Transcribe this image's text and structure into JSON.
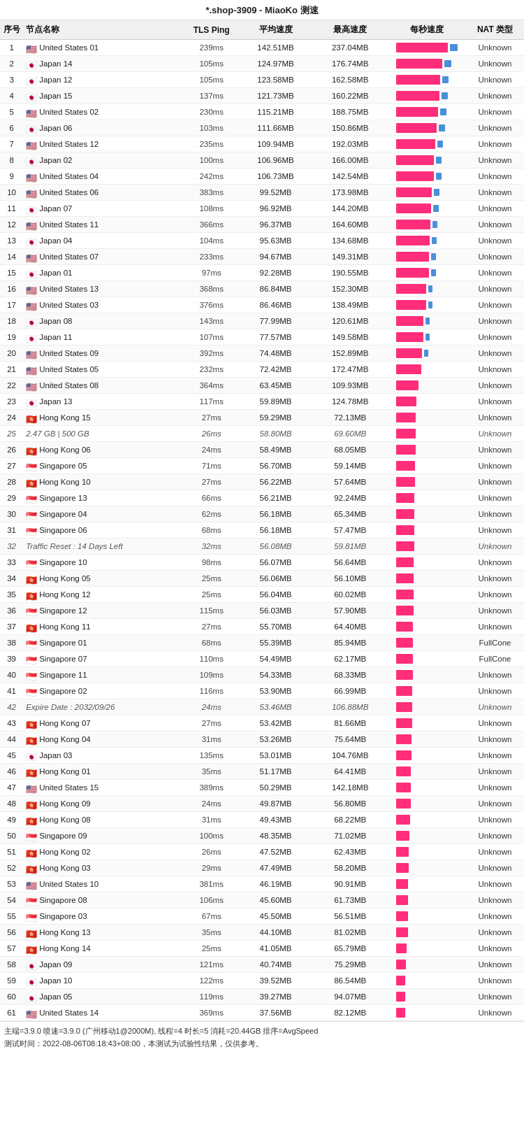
{
  "title": "*.shop-3909 - MiaoKo 测速",
  "columns": [
    "序号",
    "节点名称",
    "TLS Ping",
    "平均速度",
    "最高速度",
    "每秒速度",
    "NAT 类型"
  ],
  "rows": [
    {
      "id": 1,
      "flag": "us",
      "name": "United States 01",
      "ping": "239ms",
      "avg": "142.51MB",
      "max": "237.04MB",
      "bar": 95,
      "nat": "Unknown"
    },
    {
      "id": 2,
      "flag": "jp",
      "name": "Japan 14",
      "ping": "105ms",
      "avg": "124.97MB",
      "max": "176.74MB",
      "bar": 83,
      "nat": "Unknown"
    },
    {
      "id": 3,
      "flag": "jp",
      "name": "Japan 12",
      "ping": "105ms",
      "avg": "123.58MB",
      "max": "162.58MB",
      "bar": 80,
      "nat": "Unknown"
    },
    {
      "id": 4,
      "flag": "jp",
      "name": "Japan 15",
      "ping": "137ms",
      "avg": "121.73MB",
      "max": "160.22MB",
      "bar": 78,
      "nat": "Unknown"
    },
    {
      "id": 5,
      "flag": "us",
      "name": "United States 02",
      "ping": "230ms",
      "avg": "115.21MB",
      "max": "188.75MB",
      "bar": 76,
      "nat": "Unknown"
    },
    {
      "id": 6,
      "flag": "jp",
      "name": "Japan 06",
      "ping": "103ms",
      "avg": "111.66MB",
      "max": "150.86MB",
      "bar": 73,
      "nat": "Unknown"
    },
    {
      "id": 7,
      "flag": "us",
      "name": "United States 12",
      "ping": "235ms",
      "avg": "109.94MB",
      "max": "192.03MB",
      "bar": 71,
      "nat": "Unknown"
    },
    {
      "id": 8,
      "flag": "jp",
      "name": "Japan 02",
      "ping": "100ms",
      "avg": "106.96MB",
      "max": "166.00MB",
      "bar": 69,
      "nat": "Unknown"
    },
    {
      "id": 9,
      "flag": "us",
      "name": "United States 04",
      "ping": "242ms",
      "avg": "106.73MB",
      "max": "142.54MB",
      "bar": 68,
      "nat": "Unknown"
    },
    {
      "id": 10,
      "flag": "us",
      "name": "United States 06",
      "ping": "383ms",
      "avg": "99.52MB",
      "max": "173.98MB",
      "bar": 65,
      "nat": "Unknown"
    },
    {
      "id": 11,
      "flag": "jp",
      "name": "Japan 07",
      "ping": "108ms",
      "avg": "96.92MB",
      "max": "144.20MB",
      "bar": 63,
      "nat": "Unknown"
    },
    {
      "id": 12,
      "flag": "us",
      "name": "United States 11",
      "ping": "366ms",
      "avg": "96.37MB",
      "max": "164.60MB",
      "bar": 62,
      "nat": "Unknown"
    },
    {
      "id": 13,
      "flag": "jp",
      "name": "Japan 04",
      "ping": "104ms",
      "avg": "95.63MB",
      "max": "134.68MB",
      "bar": 61,
      "nat": "Unknown"
    },
    {
      "id": 14,
      "flag": "us",
      "name": "United States 07",
      "ping": "233ms",
      "avg": "94.67MB",
      "max": "149.31MB",
      "bar": 60,
      "nat": "Unknown"
    },
    {
      "id": 15,
      "flag": "jp",
      "name": "Japan 01",
      "ping": "97ms",
      "avg": "92.28MB",
      "max": "190.55MB",
      "bar": 59,
      "nat": "Unknown"
    },
    {
      "id": 16,
      "flag": "us",
      "name": "United States 13",
      "ping": "368ms",
      "avg": "86.84MB",
      "max": "152.30MB",
      "bar": 55,
      "nat": "Unknown"
    },
    {
      "id": 17,
      "flag": "us",
      "name": "United States 03",
      "ping": "376ms",
      "avg": "86.46MB",
      "max": "138.49MB",
      "bar": 54,
      "nat": "Unknown"
    },
    {
      "id": 18,
      "flag": "jp",
      "name": "Japan 08",
      "ping": "143ms",
      "avg": "77.99MB",
      "max": "120.61MB",
      "bar": 50,
      "nat": "Unknown"
    },
    {
      "id": 19,
      "flag": "jp",
      "name": "Japan 11",
      "ping": "107ms",
      "avg": "77.57MB",
      "max": "149.58MB",
      "bar": 49,
      "nat": "Unknown"
    },
    {
      "id": 20,
      "flag": "us",
      "name": "United States 09",
      "ping": "392ms",
      "avg": "74.48MB",
      "max": "152.89MB",
      "bar": 47,
      "nat": "Unknown"
    },
    {
      "id": 21,
      "flag": "us",
      "name": "United States 05",
      "ping": "232ms",
      "avg": "72.42MB",
      "max": "172.47MB",
      "bar": 46,
      "nat": "Unknown"
    },
    {
      "id": 22,
      "flag": "us",
      "name": "United States 08",
      "ping": "364ms",
      "avg": "63.45MB",
      "max": "109.93MB",
      "bar": 40,
      "nat": "Unknown"
    },
    {
      "id": 23,
      "flag": "jp",
      "name": "Japan 13",
      "ping": "117ms",
      "avg": "59.89MB",
      "max": "124.78MB",
      "bar": 37,
      "nat": "Unknown"
    },
    {
      "id": 24,
      "flag": "hk",
      "name": "Hong Kong 15",
      "ping": "27ms",
      "avg": "59.29MB",
      "max": "72.13MB",
      "bar": 36,
      "nat": "Unknown"
    },
    {
      "id": 25,
      "flag": "special",
      "name": "2.47 GB | 500 GB",
      "ping": "26ms",
      "avg": "58.80MB",
      "max": "69.60MB",
      "bar": 35,
      "nat": "Unknown"
    },
    {
      "id": 26,
      "flag": "hk",
      "name": "Hong Kong 06",
      "ping": "24ms",
      "avg": "58.49MB",
      "max": "68.05MB",
      "bar": 35,
      "nat": "Unknown"
    },
    {
      "id": 27,
      "flag": "sg",
      "name": "Singapore 05",
      "ping": "71ms",
      "avg": "56.70MB",
      "max": "59.14MB",
      "bar": 34,
      "nat": "Unknown"
    },
    {
      "id": 28,
      "flag": "hk",
      "name": "Hong Kong 10",
      "ping": "27ms",
      "avg": "56.22MB",
      "max": "57.64MB",
      "bar": 34,
      "nat": "Unknown"
    },
    {
      "id": 29,
      "flag": "sg",
      "name": "Singapore 13",
      "ping": "66ms",
      "avg": "56.21MB",
      "max": "92.24MB",
      "bar": 33,
      "nat": "Unknown"
    },
    {
      "id": 30,
      "flag": "sg",
      "name": "Singapore 04",
      "ping": "62ms",
      "avg": "56.18MB",
      "max": "65.34MB",
      "bar": 33,
      "nat": "Unknown"
    },
    {
      "id": 31,
      "flag": "sg",
      "name": "Singapore 06",
      "ping": "68ms",
      "avg": "56.18MB",
      "max": "57.47MB",
      "bar": 33,
      "nat": "Unknown"
    },
    {
      "id": 32,
      "flag": "special",
      "name": "Traffic Reset : 14 Days Left",
      "ping": "32ms",
      "avg": "56.08MB",
      "max": "59.81MB",
      "bar": 33,
      "nat": "Unknown"
    },
    {
      "id": 33,
      "flag": "sg",
      "name": "Singapore 10",
      "ping": "98ms",
      "avg": "56.07MB",
      "max": "56.64MB",
      "bar": 32,
      "nat": "Unknown"
    },
    {
      "id": 34,
      "flag": "hk",
      "name": "Hong Kong 05",
      "ping": "25ms",
      "avg": "56.06MB",
      "max": "56.10MB",
      "bar": 32,
      "nat": "Unknown"
    },
    {
      "id": 35,
      "flag": "hk",
      "name": "Hong Kong 12",
      "ping": "25ms",
      "avg": "56.04MB",
      "max": "60.02MB",
      "bar": 32,
      "nat": "Unknown"
    },
    {
      "id": 36,
      "flag": "sg",
      "name": "Singapore 12",
      "ping": "115ms",
      "avg": "56.03MB",
      "max": "57.90MB",
      "bar": 32,
      "nat": "Unknown"
    },
    {
      "id": 37,
      "flag": "hk",
      "name": "Hong Kong 11",
      "ping": "27ms",
      "avg": "55.70MB",
      "max": "64.40MB",
      "bar": 31,
      "nat": "Unknown"
    },
    {
      "id": 38,
      "flag": "sg",
      "name": "Singapore 01",
      "ping": "68ms",
      "avg": "55.39MB",
      "max": "85.94MB",
      "bar": 31,
      "nat": "FullCone"
    },
    {
      "id": 39,
      "flag": "sg",
      "name": "Singapore 07",
      "ping": "110ms",
      "avg": "54.49MB",
      "max": "62.17MB",
      "bar": 30,
      "nat": "FullCone"
    },
    {
      "id": 40,
      "flag": "sg",
      "name": "Singapore 11",
      "ping": "109ms",
      "avg": "54.33MB",
      "max": "68.33MB",
      "bar": 30,
      "nat": "Unknown"
    },
    {
      "id": 41,
      "flag": "sg",
      "name": "Singapore 02",
      "ping": "116ms",
      "avg": "53.90MB",
      "max": "66.99MB",
      "bar": 29,
      "nat": "Unknown"
    },
    {
      "id": 42,
      "flag": "special",
      "name": "Expire Date : 2032/09/26",
      "ping": "24ms",
      "avg": "53.46MB",
      "max": "106.88MB",
      "bar": 29,
      "nat": "Unknown"
    },
    {
      "id": 43,
      "flag": "hk",
      "name": "Hong Kong 07",
      "ping": "27ms",
      "avg": "53.42MB",
      "max": "81.66MB",
      "bar": 29,
      "nat": "Unknown"
    },
    {
      "id": 44,
      "flag": "hk",
      "name": "Hong Kong 04",
      "ping": "31ms",
      "avg": "53.26MB",
      "max": "75.64MB",
      "bar": 28,
      "nat": "Unknown"
    },
    {
      "id": 45,
      "flag": "jp",
      "name": "Japan 03",
      "ping": "135ms",
      "avg": "53.01MB",
      "max": "104.76MB",
      "bar": 28,
      "nat": "Unknown"
    },
    {
      "id": 46,
      "flag": "hk",
      "name": "Hong Kong 01",
      "ping": "35ms",
      "avg": "51.17MB",
      "max": "64.41MB",
      "bar": 27,
      "nat": "Unknown"
    },
    {
      "id": 47,
      "flag": "us",
      "name": "United States 15",
      "ping": "389ms",
      "avg": "50.29MB",
      "max": "142.18MB",
      "bar": 27,
      "nat": "Unknown"
    },
    {
      "id": 48,
      "flag": "hk",
      "name": "Hong Kong 09",
      "ping": "24ms",
      "avg": "49.87MB",
      "max": "56.80MB",
      "bar": 26,
      "nat": "Unknown"
    },
    {
      "id": 49,
      "flag": "hk",
      "name": "Hong Kong 08",
      "ping": "31ms",
      "avg": "49.43MB",
      "max": "68.22MB",
      "bar": 25,
      "nat": "Unknown"
    },
    {
      "id": 50,
      "flag": "sg",
      "name": "Singapore 09",
      "ping": "100ms",
      "avg": "48.35MB",
      "max": "71.02MB",
      "bar": 24,
      "nat": "Unknown"
    },
    {
      "id": 51,
      "flag": "hk",
      "name": "Hong Kong 02",
      "ping": "26ms",
      "avg": "47.52MB",
      "max": "62.43MB",
      "bar": 23,
      "nat": "Unknown"
    },
    {
      "id": 52,
      "flag": "hk",
      "name": "Hong Kong 03",
      "ping": "29ms",
      "avg": "47.49MB",
      "max": "58.20MB",
      "bar": 23,
      "nat": "Unknown"
    },
    {
      "id": 53,
      "flag": "us",
      "name": "United States 10",
      "ping": "381ms",
      "avg": "46.19MB",
      "max": "90.91MB",
      "bar": 22,
      "nat": "Unknown"
    },
    {
      "id": 54,
      "flag": "sg",
      "name": "Singapore 08",
      "ping": "106ms",
      "avg": "45.60MB",
      "max": "61.73MB",
      "bar": 22,
      "nat": "Unknown"
    },
    {
      "id": 55,
      "flag": "sg",
      "name": "Singapore 03",
      "ping": "67ms",
      "avg": "45.50MB",
      "max": "56.51MB",
      "bar": 21,
      "nat": "Unknown"
    },
    {
      "id": 56,
      "flag": "hk",
      "name": "Hong Kong 13",
      "ping": "35ms",
      "avg": "44.10MB",
      "max": "81.02MB",
      "bar": 21,
      "nat": "Unknown"
    },
    {
      "id": 57,
      "flag": "hk",
      "name": "Hong Kong 14",
      "ping": "25ms",
      "avg": "41.05MB",
      "max": "65.79MB",
      "bar": 19,
      "nat": "Unknown"
    },
    {
      "id": 58,
      "flag": "jp",
      "name": "Japan 09",
      "ping": "121ms",
      "avg": "40.74MB",
      "max": "75.29MB",
      "bar": 18,
      "nat": "Unknown"
    },
    {
      "id": 59,
      "flag": "jp",
      "name": "Japan 10",
      "ping": "122ms",
      "avg": "39.52MB",
      "max": "86.54MB",
      "bar": 17,
      "nat": "Unknown"
    },
    {
      "id": 60,
      "flag": "jp",
      "name": "Japan 05",
      "ping": "119ms",
      "avg": "39.27MB",
      "max": "94.07MB",
      "bar": 17,
      "nat": "Unknown"
    },
    {
      "id": 61,
      "flag": "us",
      "name": "United States 14",
      "ping": "369ms",
      "avg": "37.56MB",
      "max": "82.12MB",
      "bar": 16,
      "nat": "Unknown"
    }
  ],
  "footer": {
    "line1": "主端=3.9.0 喷速=3.9.0 (广州移动1@2000M), 线程=4 时长=5 消耗=20.44GB 排序=AvgSpeed",
    "line2": "测试时间：2022-08-06T08:18:43+08:00，本测试为试验性结果，仅供参考。"
  },
  "flags": {
    "us": "🇺🇸",
    "jp": "🇯🇵",
    "hk": "🇭🇰",
    "sg": "🇸🇬"
  }
}
